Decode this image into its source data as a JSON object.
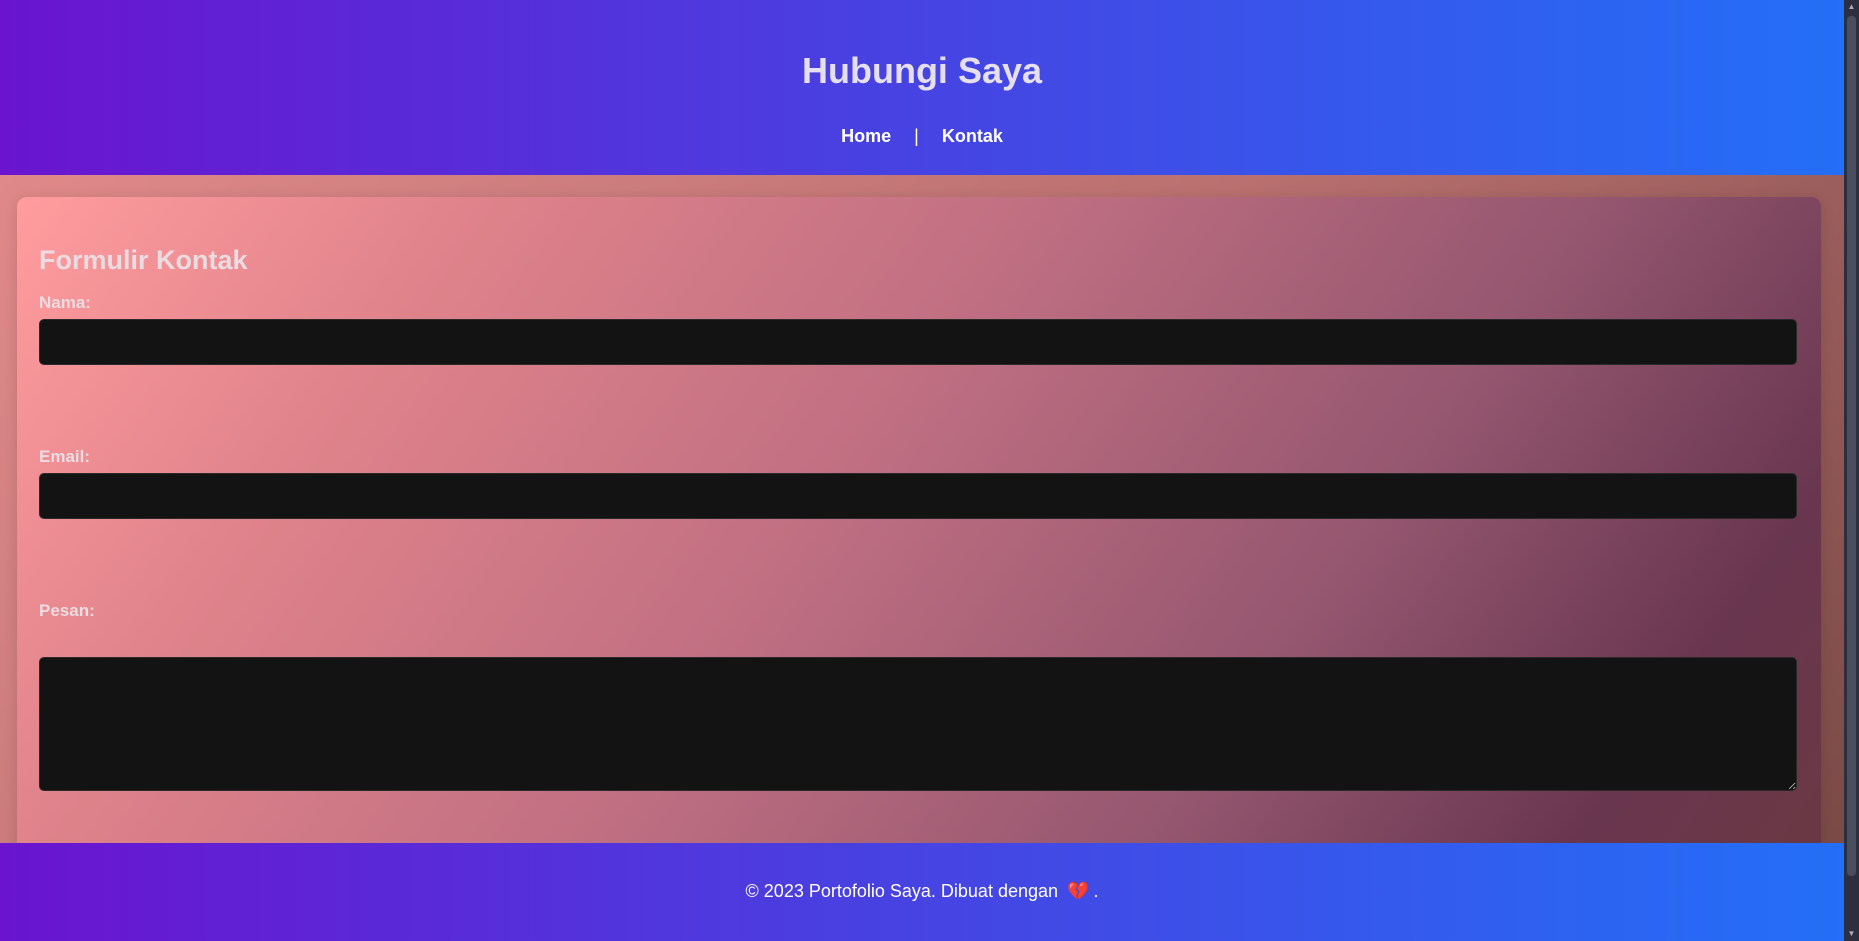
{
  "header": {
    "title": "Hubungi Saya",
    "nav": {
      "home": "Home",
      "separator": "|",
      "contact": "Kontak"
    }
  },
  "form": {
    "title": "Formulir Kontak",
    "name_label": "Nama:",
    "name_value": "",
    "email_label": "Email:",
    "email_value": "",
    "message_label": "Pesan:",
    "message_value": ""
  },
  "footer": {
    "text_before": "© 2023 Portofolio Saya. Dibuat dengan",
    "heart": "💔",
    "text_after": "."
  },
  "colors": {
    "header_start": "#6a14cf",
    "header_end": "#236ff7",
    "field_bg": "#131313",
    "label_text": "#ebdce2"
  }
}
